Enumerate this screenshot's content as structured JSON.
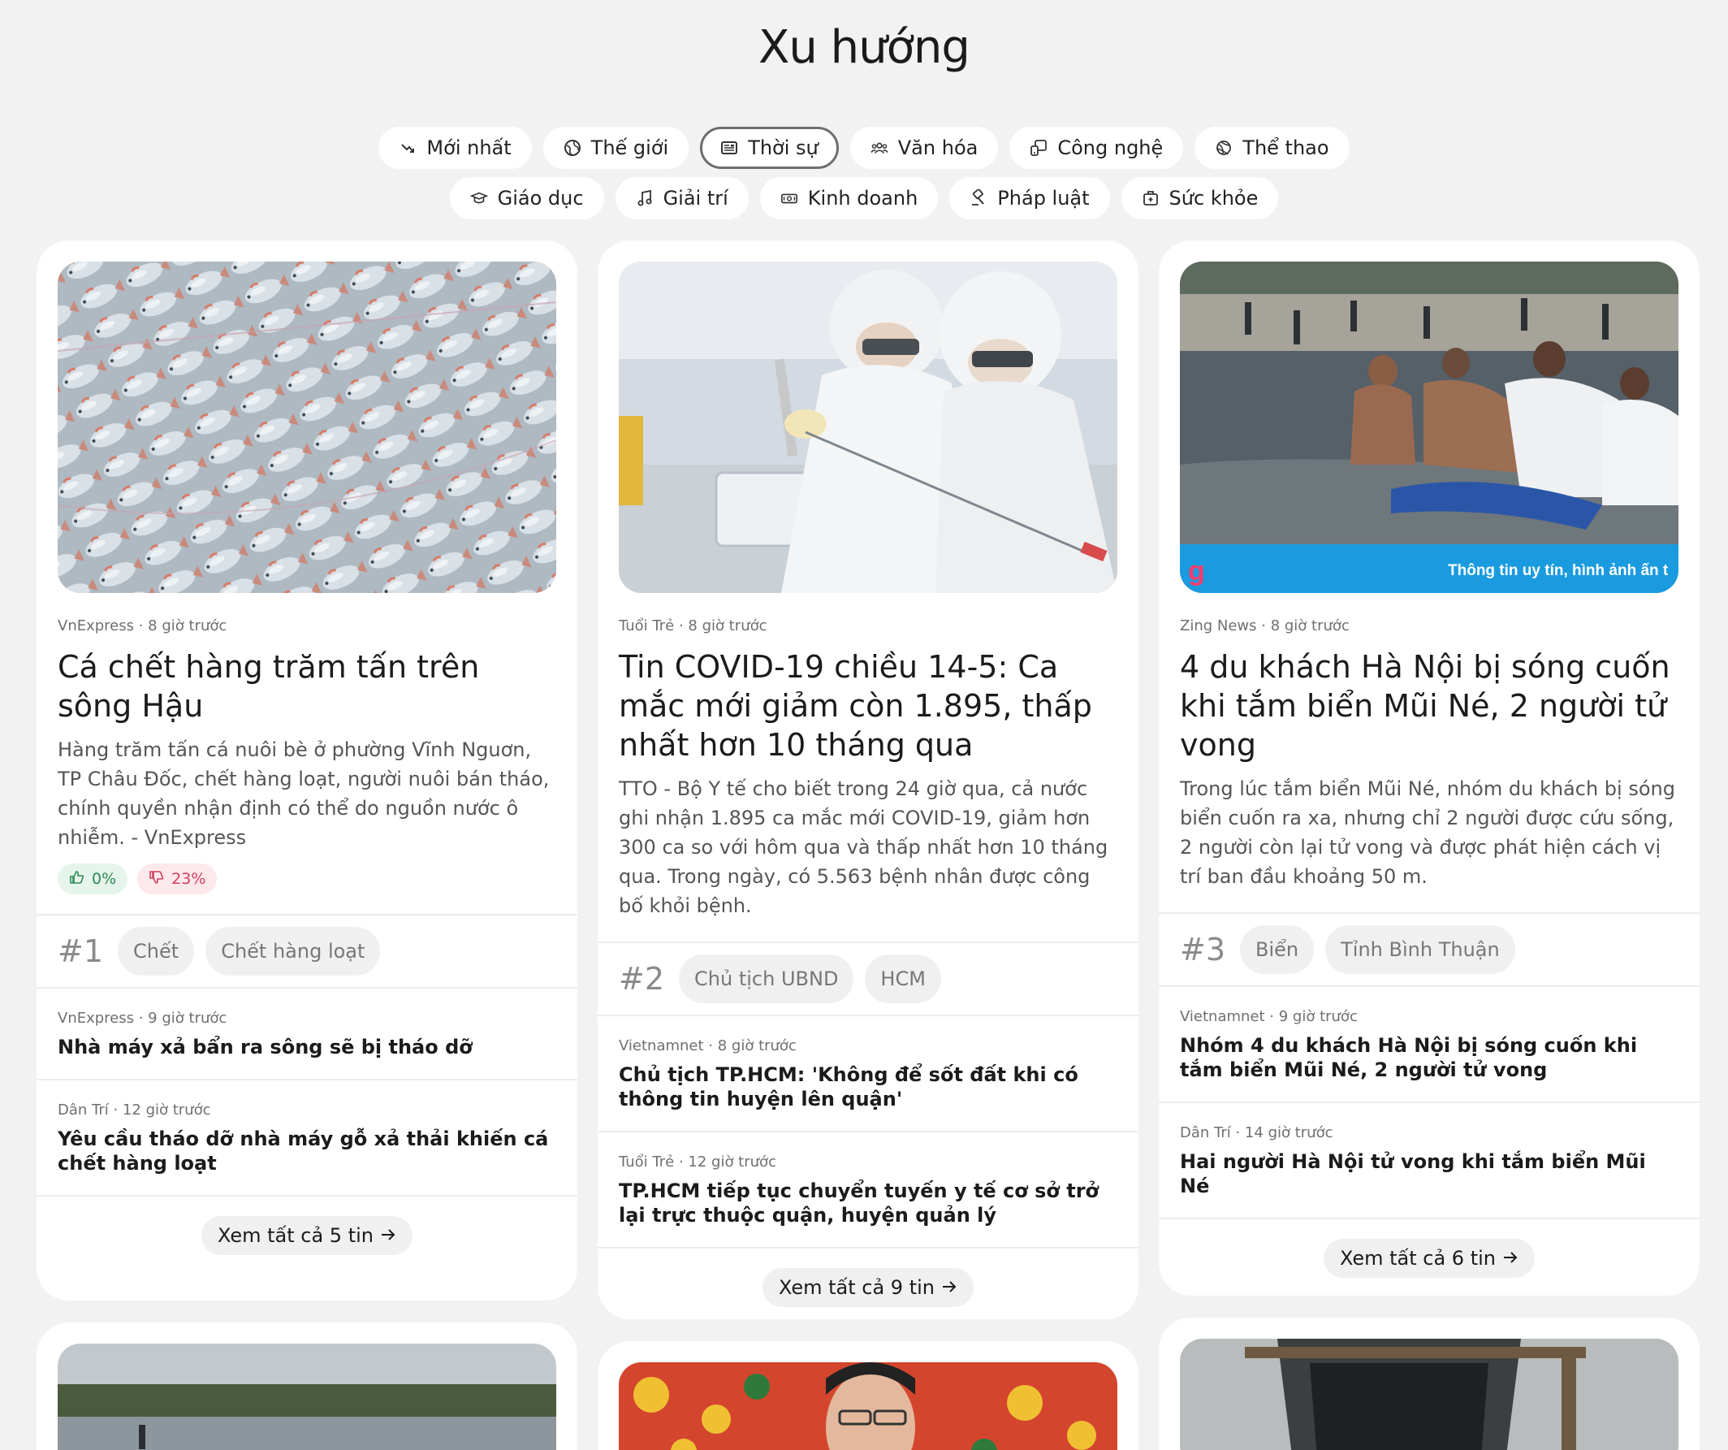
{
  "title": "Xu hướng",
  "filters_row1": [
    {
      "label": "Mới nhất",
      "icon": "trending-icon"
    },
    {
      "label": "Thế giới",
      "icon": "globe-icon"
    },
    {
      "label": "Thời sự",
      "icon": "newspaper-icon",
      "active": true
    },
    {
      "label": "Văn hóa",
      "icon": "people-icon"
    },
    {
      "label": "Công nghệ",
      "icon": "devices-icon"
    },
    {
      "label": "Thể thao",
      "icon": "ball-icon"
    }
  ],
  "filters_row2": [
    {
      "label": "Giáo dục",
      "icon": "graduation-cap-icon"
    },
    {
      "label": "Giải trí",
      "icon": "music-note-icon"
    },
    {
      "label": "Kinh doanh",
      "icon": "cash-icon"
    },
    {
      "label": "Pháp luật",
      "icon": "gavel-icon"
    },
    {
      "label": "Sức khỏe",
      "icon": "first-aid-icon"
    }
  ],
  "cards": [
    {
      "source": "VnExpress · 8 giờ trước",
      "headline": "Cá chết hàng trăm tấn trên sông Hậu",
      "summary": "Hàng trăm tấn cá nuôi bè ở phường Vĩnh Nguơn, TP Châu Đốc, chết hàng loạt, người nuôi bán tháo, chính quyền nhận định có thể do nguồn nước ô nhiễm. - VnExpress",
      "like": "0%",
      "dislike": "23%",
      "rank": "#1",
      "tags": [
        "Chết",
        "Chết hàng loạt"
      ],
      "related": [
        {
          "meta": "VnExpress · 9 giờ trước",
          "title": "Nhà máy xả bẩn ra sông sẽ bị tháo dỡ"
        },
        {
          "meta": "Dân Trí · 12 giờ trước",
          "title": "Yêu cầu tháo dỡ nhà máy gỗ xả thải khiến cá chết hàng loạt"
        }
      ],
      "see_all": "Xem tất cả 5 tin"
    },
    {
      "source": "Tuổi Trẻ · 8 giờ trước",
      "headline": "Tin COVID-19 chiều 14-5: Ca mắc mới giảm còn 1.895, thấp nhất hơn 10 tháng qua",
      "summary": "TTO - Bộ Y tế cho biết trong 24 giờ qua, cả nước ghi nhận 1.895 ca mắc mới COVID-19, giảm hơn 300 ca so với hôm qua và thấp nhất hơn 10 tháng qua. Trong ngày, có 5.563 bệnh nhân được công bố khỏi bệnh.",
      "rank": "#2",
      "tags": [
        "Chủ tịch UBND",
        "HCM"
      ],
      "related": [
        {
          "meta": "Vietnamnet · 8 giờ trước",
          "title": "Chủ tịch TP.HCM: 'Không để sốt đất khi có thông tin huyện lên quận'"
        },
        {
          "meta": "Tuổi Trẻ · 12 giờ trước",
          "title": "TP.HCM tiếp tục chuyển tuyến y tế cơ sở trở lại trực thuộc quận, huyện quản lý"
        }
      ],
      "see_all": "Xem tất cả 9 tin"
    },
    {
      "source": "Zing News · 8 giờ trước",
      "headline": "4 du khách Hà Nội bị sóng cuốn khi tắm biển Mũi Né, 2 người tử vong",
      "summary": "Trong lúc tắm biển Mũi Né, nhóm du khách bị sóng biển cuốn ra xa, nhưng chỉ 2 người được cứu sống, 2 người còn lại tử vong và được phát hiện cách vị trí ban đầu khoảng 50 m.",
      "image_caption": "Thông tin uy tín, hình ảnh ấn t",
      "image_badge": "g",
      "rank": "#3",
      "tags": [
        "Biển",
        "Tỉnh Bình Thuận"
      ],
      "related": [
        {
          "meta": "Vietnamnet · 9 giờ trước",
          "title": "Nhóm 4 du khách Hà Nội bị sóng cuốn khi tắm biển Mũi Né, 2 người tử vong"
        },
        {
          "meta": "Dân Trí · 14 giờ trước",
          "title": "Hai người Hà Nội tử vong khi tắm biển Mũi Né"
        }
      ],
      "see_all": "Xem tất cả 6 tin"
    }
  ],
  "colors": {
    "background": "#f2f2f2",
    "like": "#2d8a55",
    "dislike": "#d0405e",
    "caption_bar": "#1a9be0"
  }
}
